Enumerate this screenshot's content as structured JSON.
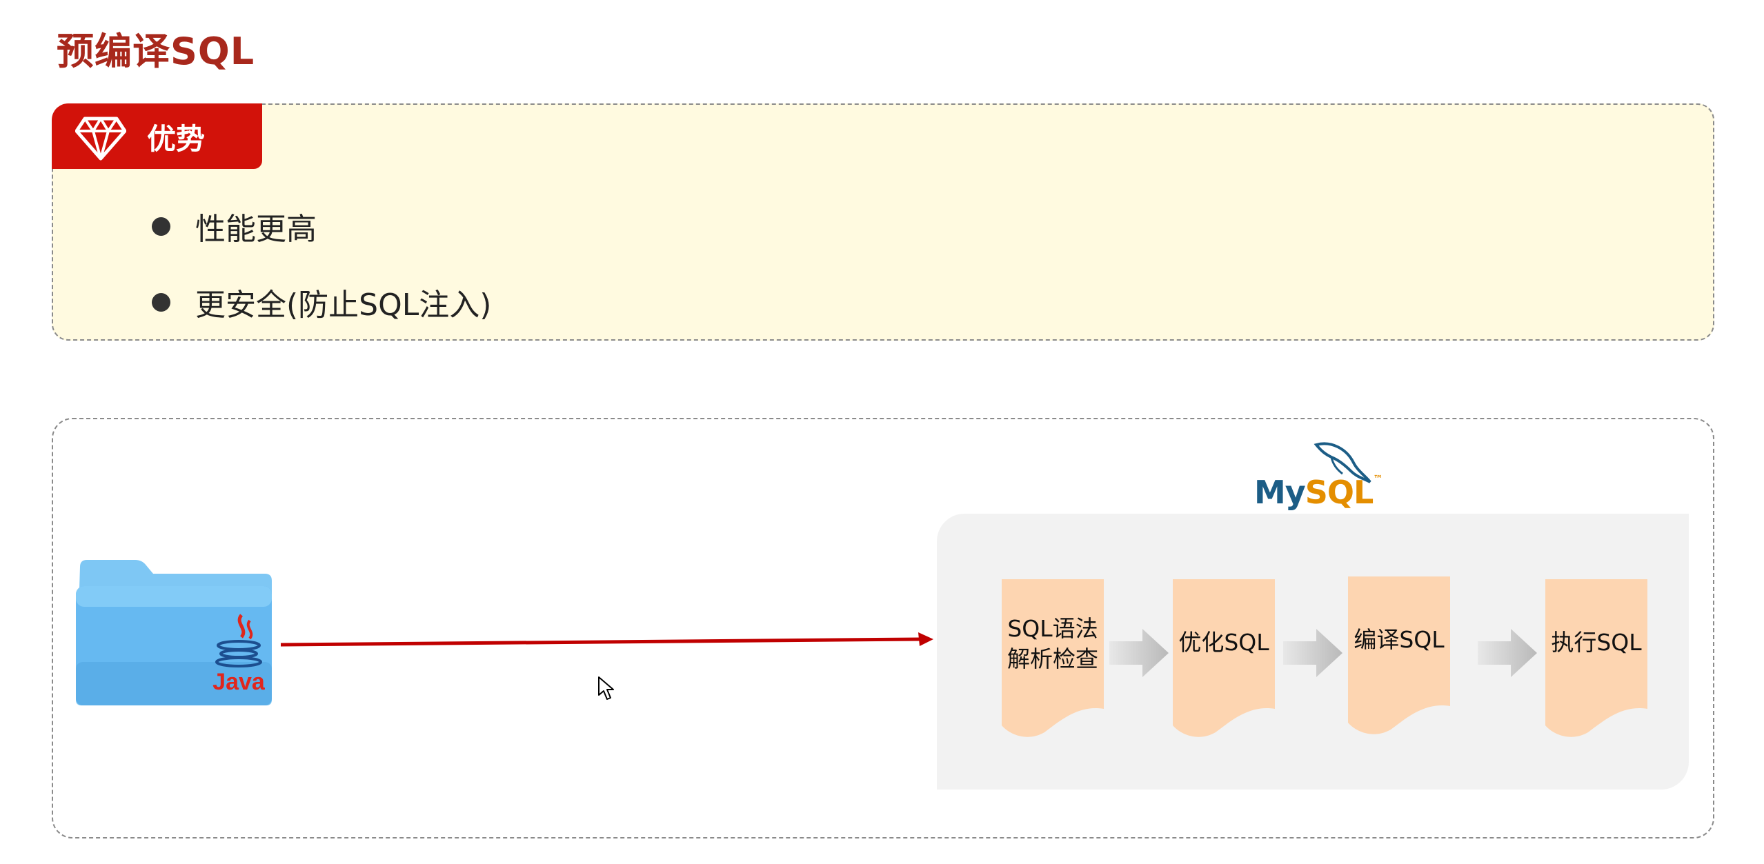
{
  "page": {
    "title": "预编译SQL"
  },
  "advantages": {
    "tab_label": "优势",
    "items": [
      "性能更高",
      "更安全(防止SQL注入)"
    ]
  },
  "diagram": {
    "source_label": "Java",
    "db_logo": {
      "my": "My",
      "sql": "SQL",
      "tm": "™"
    },
    "steps": [
      {
        "label_line1": "SQL语法",
        "label_line2": "解析检查"
      },
      {
        "label_line1": "优化SQL",
        "label_line2": ""
      },
      {
        "label_line1": "编译SQL",
        "label_line2": ""
      },
      {
        "label_line1": "执行SQL",
        "label_line2": ""
      }
    ]
  },
  "colors": {
    "title": "#a8281c",
    "tab_red": "#d2120a",
    "advantage_bg": "#fffae0",
    "step_fill": "#fdd5b1",
    "panel_gray": "#f2f2f2",
    "arrow_red": "#c00000",
    "mysql_blue": "#1c5d86",
    "mysql_orange": "#e48e00"
  },
  "icons": [
    "diamond-icon",
    "folder-icon",
    "java-icon",
    "dolphin-icon",
    "arrow-right-icon",
    "cursor-icon"
  ]
}
